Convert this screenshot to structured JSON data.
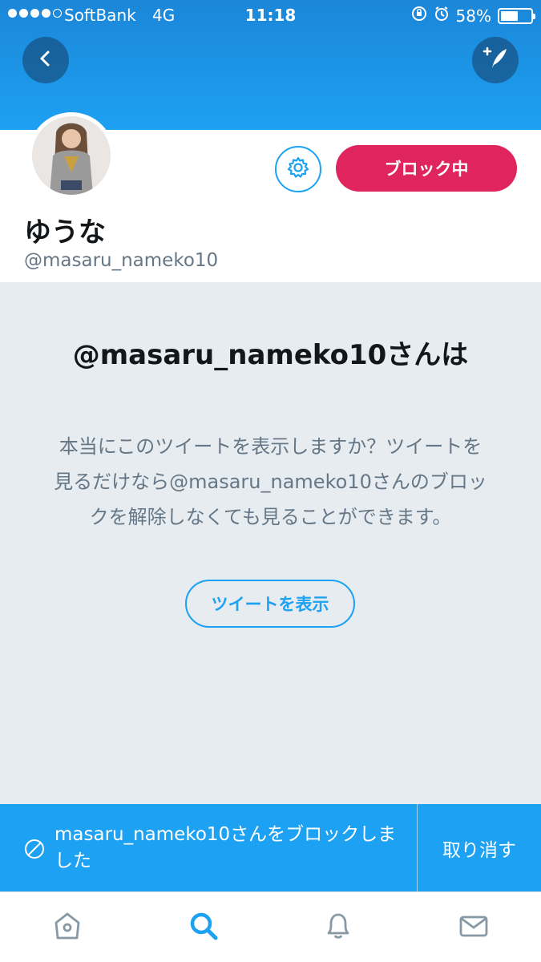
{
  "status_bar": {
    "carrier": "SoftBank",
    "network": "4G",
    "time": "11:18",
    "battery_percent": "58%",
    "battery_level": 0.58
  },
  "profile": {
    "display_name": "ゆうな",
    "handle": "@masaru_nameko10",
    "blocked_button_label": "ブロック中"
  },
  "blocked_notice": {
    "title": "@masaru_nameko10さんは",
    "message": "本当にこのツイートを表示しますか？ツイートを見るだけなら@masaru_nameko10さんのブロックを解除しなくても見ることができます。",
    "view_button_label": "ツイートを表示"
  },
  "snackbar": {
    "message": "masaru_nameko10さんをブロックしました",
    "undo_label": "取り消す"
  },
  "icons": {
    "back": "chevron-left-icon",
    "compose": "compose-tweet-icon",
    "settings": "gear-icon",
    "blocked": "block-circle-icon",
    "tabs": [
      "home-icon",
      "search-icon",
      "bell-icon",
      "mail-icon"
    ]
  },
  "colors": {
    "accent": "#1da1f2",
    "blocked_button": "#e0245e",
    "background": "#e6ecf0"
  }
}
